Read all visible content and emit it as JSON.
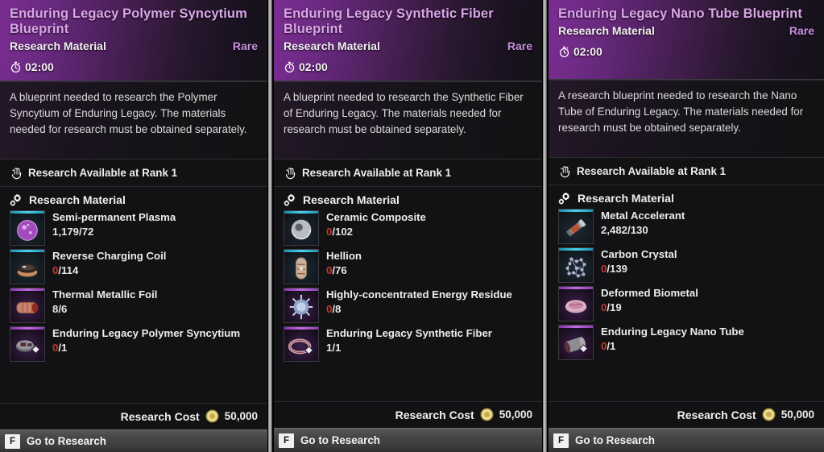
{
  "panels": [
    {
      "title": "Enduring Legacy Polymer Syncytium Blueprint",
      "subtype": "Research Material",
      "rarity": "Rare",
      "timer": "02:00",
      "timer_icon": "stopwatch-icon",
      "description": "A blueprint needed to research the Polymer Syncytium of Enduring Legacy. The materials needed for research must be obtained separately.",
      "rank_text": "Research Available at Rank 1",
      "rank_icon": "rank-hand-icon",
      "materials_label": "Research Material",
      "materials_icon": "gears-icon",
      "materials": [
        {
          "name": "Semi-permanent Plasma",
          "have": "1,179",
          "need": "72",
          "zero": false,
          "tier": "common",
          "art": "plasma-orb-icon"
        },
        {
          "name": "Reverse Charging Coil",
          "have": "0",
          "need": "114",
          "zero": true,
          "tier": "common",
          "art": "coil-icon"
        },
        {
          "name": "Thermal Metallic Foil",
          "have": "8",
          "need": "6",
          "zero": false,
          "tier": "rare",
          "art": "foil-roll-icon"
        },
        {
          "name": "Enduring Legacy Polymer Syncytium",
          "have": "0",
          "need": "1",
          "zero": true,
          "tier": "rare",
          "art": "blueprint-plates-icon"
        }
      ],
      "cost_label": "Research Cost",
      "cost_icon": "gold-coin-icon",
      "cost_value": "50,000",
      "footer_key": "F",
      "footer_label": "Go to Research"
    },
    {
      "title": "Enduring Legacy Synthetic Fiber Blueprint",
      "subtype": "Research Material",
      "rarity": "Rare",
      "timer": "02:00",
      "timer_icon": "stopwatch-icon",
      "description": "A blueprint needed to research the Synthetic Fiber of Enduring Legacy. The materials needed for research must be obtained separately.",
      "rank_text": "Research Available at Rank 1",
      "rank_icon": "rank-hand-icon",
      "materials_label": "Research Material",
      "materials_icon": "gears-icon",
      "materials": [
        {
          "name": "Ceramic Composite",
          "have": "0",
          "need": "102",
          "zero": true,
          "tier": "common",
          "art": "ceramic-sphere-icon"
        },
        {
          "name": "Hellion",
          "have": "0",
          "need": "76",
          "zero": true,
          "tier": "common",
          "art": "hellion-capsule-icon"
        },
        {
          "name": "Highly-concentrated Energy Residue",
          "have": "0",
          "need": "8",
          "zero": true,
          "tier": "rare",
          "art": "energy-residue-icon"
        },
        {
          "name": "Enduring Legacy Synthetic Fiber",
          "have": "1",
          "need": "1",
          "zero": false,
          "tier": "rare",
          "art": "fiber-ring-icon"
        }
      ],
      "cost_label": "Research Cost",
      "cost_icon": "gold-coin-icon",
      "cost_value": "50,000",
      "footer_key": "F",
      "footer_label": "Go to Research"
    },
    {
      "title": "Enduring Legacy Nano Tube Blueprint",
      "subtype": "Research Material",
      "rarity": "Rare",
      "timer": "02:00",
      "timer_icon": "stopwatch-icon",
      "description": "A research blueprint needed to research the Nano Tube of Enduring Legacy. The materials needed for research must be obtained separately.",
      "rank_text": "Research Available at Rank 1",
      "rank_icon": "rank-hand-icon",
      "materials_label": "Research Material",
      "materials_icon": "gears-icon",
      "materials": [
        {
          "name": "Metal Accelerant",
          "have": "2,482",
          "need": "130",
          "zero": false,
          "tier": "common",
          "art": "accelerant-rod-icon"
        },
        {
          "name": "Carbon Crystal",
          "have": "0",
          "need": "139",
          "zero": true,
          "tier": "common",
          "art": "carbon-lattice-icon"
        },
        {
          "name": "Deformed Biometal",
          "have": "0",
          "need": "19",
          "zero": true,
          "tier": "rare",
          "art": "biometal-dish-icon"
        },
        {
          "name": "Enduring Legacy Nano Tube",
          "have": "0",
          "need": "1",
          "zero": true,
          "tier": "rare",
          "art": "nano-tube-icon"
        }
      ],
      "cost_label": "Research Cost",
      "cost_icon": "gold-coin-icon",
      "cost_value": "50,000",
      "footer_key": "F",
      "footer_label": "Go to Research"
    }
  ],
  "colors": {
    "title": "#d9a6e8",
    "rarity": "#c88fe0",
    "missing": "#c0392f",
    "header_accent": "#7b2d92",
    "coin": "#d8c264",
    "tier_rare": "#c56ae0",
    "tier_common": "#49d3ee"
  }
}
